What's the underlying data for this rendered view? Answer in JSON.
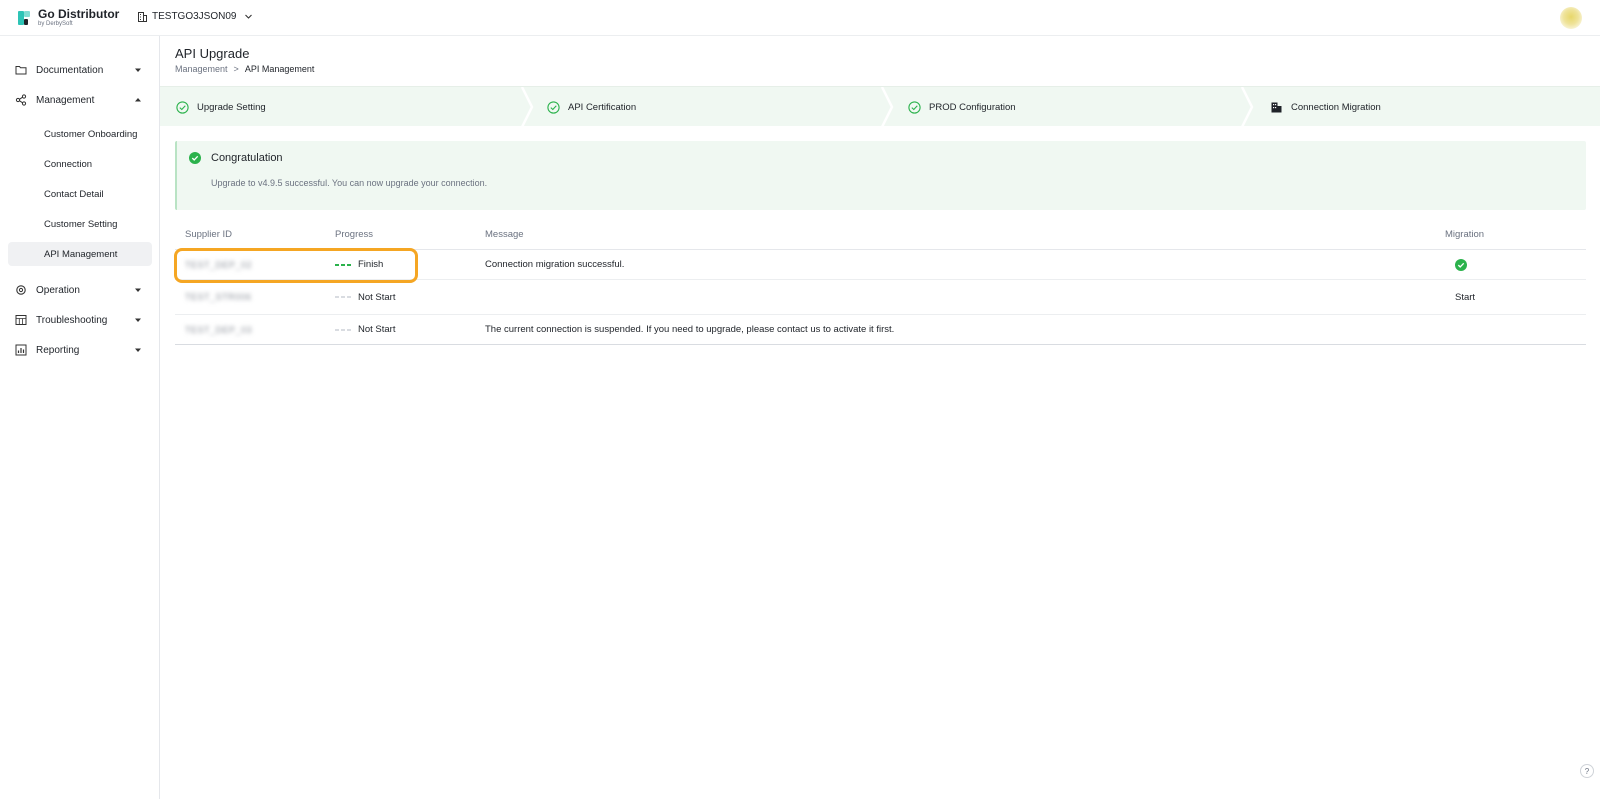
{
  "app": {
    "name": "Go Distributor",
    "byline": "by DerbySoft",
    "tenant": "TESTGO3JSON09"
  },
  "sidebar": {
    "items": [
      {
        "label": "Documentation",
        "icon": "folder-icon",
        "expanded": false
      },
      {
        "label": "Management",
        "icon": "share-nodes-icon",
        "expanded": true,
        "children": [
          {
            "label": "Customer Onboarding"
          },
          {
            "label": "Connection"
          },
          {
            "label": "Contact Detail"
          },
          {
            "label": "Customer Setting"
          },
          {
            "label": "API Management",
            "active": true
          }
        ]
      },
      {
        "label": "Operation",
        "icon": "gear-icon",
        "expanded": false
      },
      {
        "label": "Troubleshooting",
        "icon": "calendar-grid-icon",
        "expanded": false
      },
      {
        "label": "Reporting",
        "icon": "report-chart-icon",
        "expanded": false
      }
    ]
  },
  "page": {
    "title": "API Upgrade",
    "breadcrumb": {
      "parent": "Management",
      "separator": ">",
      "current": "API Management"
    }
  },
  "steps": [
    {
      "label": "Upgrade Setting",
      "status": "done",
      "icon": "check-circle-icon"
    },
    {
      "label": "API Certification",
      "status": "done",
      "icon": "check-circle-icon"
    },
    {
      "label": "PROD Configuration",
      "status": "done",
      "icon": "check-circle-icon"
    },
    {
      "label": "Connection Migration",
      "status": "current",
      "icon": "building-icon"
    }
  ],
  "alert": {
    "title": "Congratulation",
    "message": "Upgrade to v4.9.5 successful. You can now upgrade your connection."
  },
  "table": {
    "columns": {
      "supplier": "Supplier ID",
      "progress": "Progress",
      "message": "Message",
      "migration": "Migration"
    },
    "rows": [
      {
        "supplier_id": "TEST_DEP_02",
        "progress": "Finish",
        "progress_state": "done",
        "message": "Connection migration successful.",
        "migration": "success"
      },
      {
        "supplier_id": "TEST_STR006",
        "progress": "Not Start",
        "progress_state": "none",
        "message": "",
        "migration": "Start"
      },
      {
        "supplier_id": "TEST_DEP_03",
        "progress": "Not Start",
        "progress_state": "none",
        "message": "The current connection is suspended. If you need to upgrade, please contact us to activate it first.",
        "migration": ""
      }
    ]
  },
  "colors": {
    "accent_green": "#2bb24c",
    "highlight": "#f5a623",
    "step_bg": "#f0f8f2",
    "brand": "#2ec4b6"
  },
  "help": {
    "icon": "help-circle-icon",
    "glyph": "?"
  }
}
